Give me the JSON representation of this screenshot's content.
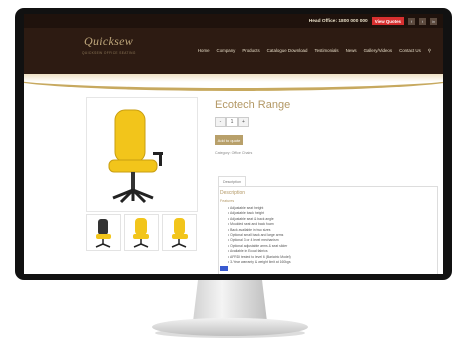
{
  "topbar": {
    "head_office": "Head Office: 1800 000 000",
    "view_quotes": "View Quotes"
  },
  "logo": {
    "name": "Quicksew",
    "tagline": "QUICKSEW OFFICE SEATING"
  },
  "nav": [
    "Home",
    "Company",
    "Products",
    "Catalogue Download",
    "Testimonials",
    "News",
    "Gallery/Videos",
    "Contact Us"
  ],
  "product": {
    "title": "Ecotech Range",
    "qty_value": "1",
    "qty_minus": "-",
    "qty_plus": "+",
    "add_button": "Add to quote",
    "category": "Category: Office Chairs",
    "tab_label": "Description",
    "description_title": "Description",
    "features_title": "Features",
    "features": [
      "Adjustable seat height",
      "Adjustable back height",
      "Adjustable seat & back angle",
      "Moulded seat and back foam",
      "Back available in two sizes",
      "Optional small back and large arms",
      "Optional 3 or 4 level mechanism",
      "Optional adjustable arms & seat slider",
      "Available in Ecoal fabrics",
      "AFRDI tested to level 6 (Bariatric Model)",
      "3-Year warranty & weight limit at 160kgs"
    ]
  },
  "colors": {
    "accent_gold": "#b39865",
    "header_brown": "#2d1b12",
    "quote_red": "#d73030",
    "chair_yellow": "#f2c51b"
  }
}
